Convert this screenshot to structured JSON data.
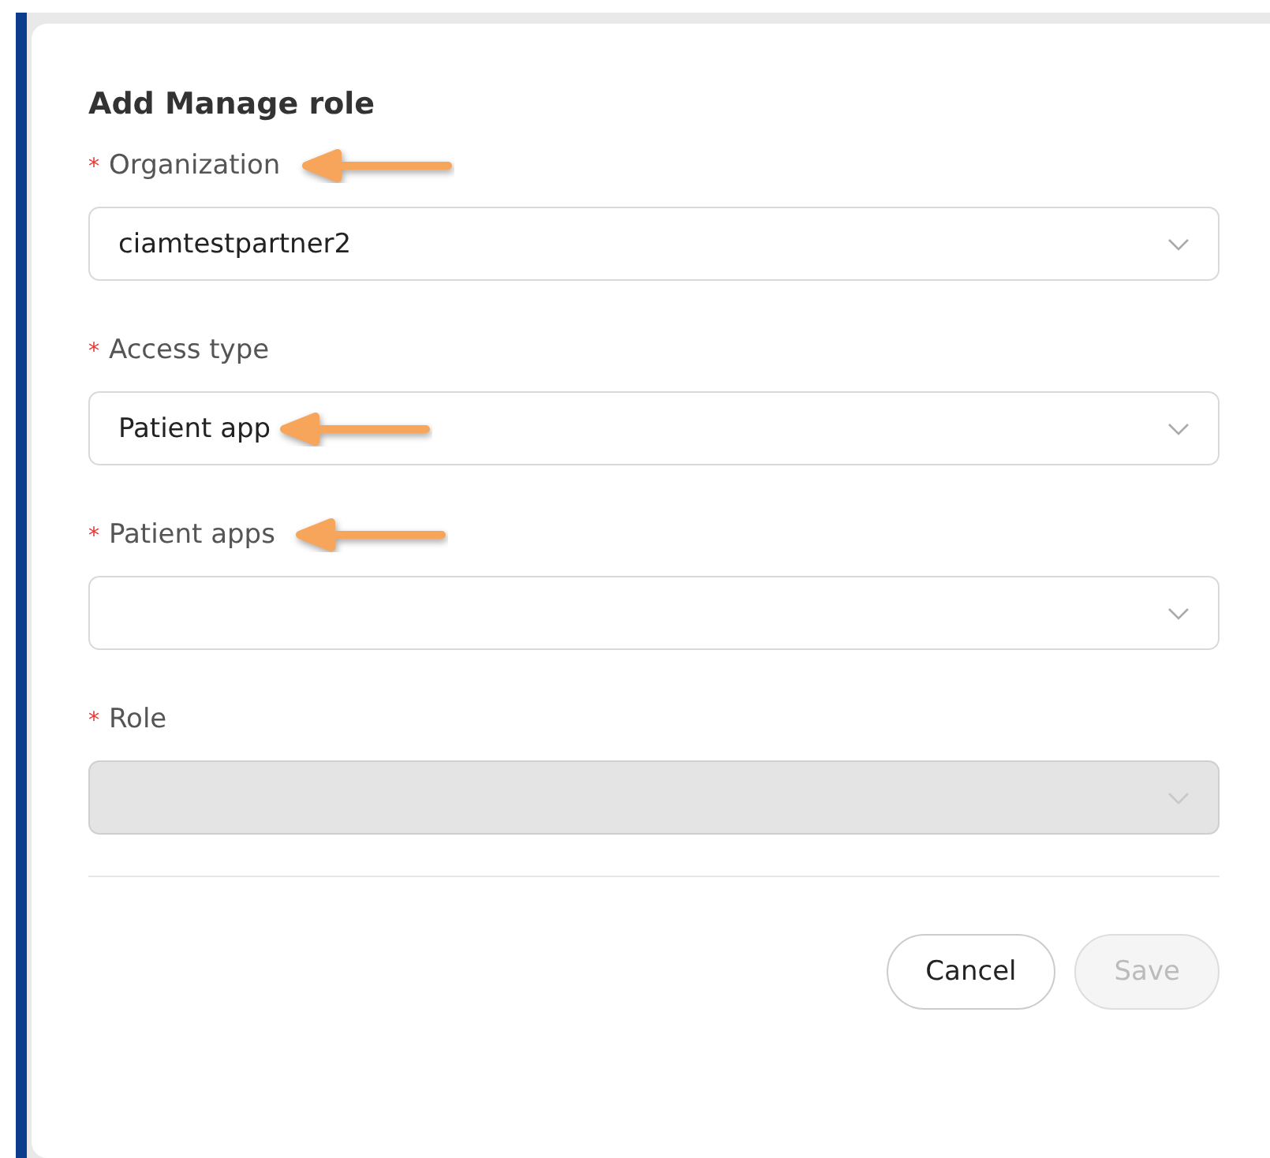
{
  "dialog": {
    "title": "Add Manage role",
    "fields": [
      {
        "label": "Organization",
        "required_mark": "*",
        "value": "ciamtestpartner2",
        "disabled": false,
        "label_arrow": true,
        "value_arrow": false
      },
      {
        "label": "Access type",
        "required_mark": "*",
        "value": "Patient app",
        "disabled": false,
        "label_arrow": false,
        "value_arrow": true
      },
      {
        "label": "Patient apps",
        "required_mark": "*",
        "disabled": false,
        "label_arrow": true,
        "value_arrow": false
      },
      {
        "label": "Role",
        "required_mark": "*",
        "disabled": true,
        "label_arrow": false,
        "value_arrow": false
      }
    ],
    "buttons": [
      {
        "label": "Cancel",
        "disabled": false
      },
      {
        "label": "Save",
        "disabled": true
      }
    ]
  }
}
